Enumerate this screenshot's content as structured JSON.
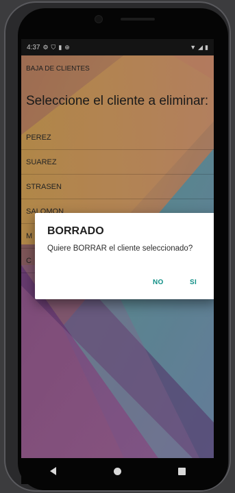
{
  "status_bar": {
    "time": "4:37",
    "left_icons": [
      "gear-icon",
      "shield-icon",
      "sim-icon",
      "vpn-icon"
    ],
    "right_icons": [
      "wifi-icon",
      "signal-icon",
      "battery-icon"
    ]
  },
  "app": {
    "title": "BAJA DE CLIENTES",
    "heading": "Seleccione el cliente a eliminar:"
  },
  "clients": [
    "PEREZ",
    "SUAREZ",
    "STRASEN",
    "SALOMON",
    "M",
    "C"
  ],
  "dialog": {
    "title": "BORRADO",
    "message": "Quiere BORRAR el cliente seleccionado?",
    "negative_label": "NO",
    "positive_label": "SI"
  },
  "colors": {
    "dialog_button": "#0f8f86",
    "status_bar": "#1a1a1a",
    "wallpaper_orange": "#e0a060",
    "wallpaper_purple": "#8a4a8f",
    "wallpaper_teal": "#4aa6b2"
  },
  "nav": {
    "buttons": [
      "back-icon",
      "home-icon",
      "recents-icon"
    ]
  }
}
